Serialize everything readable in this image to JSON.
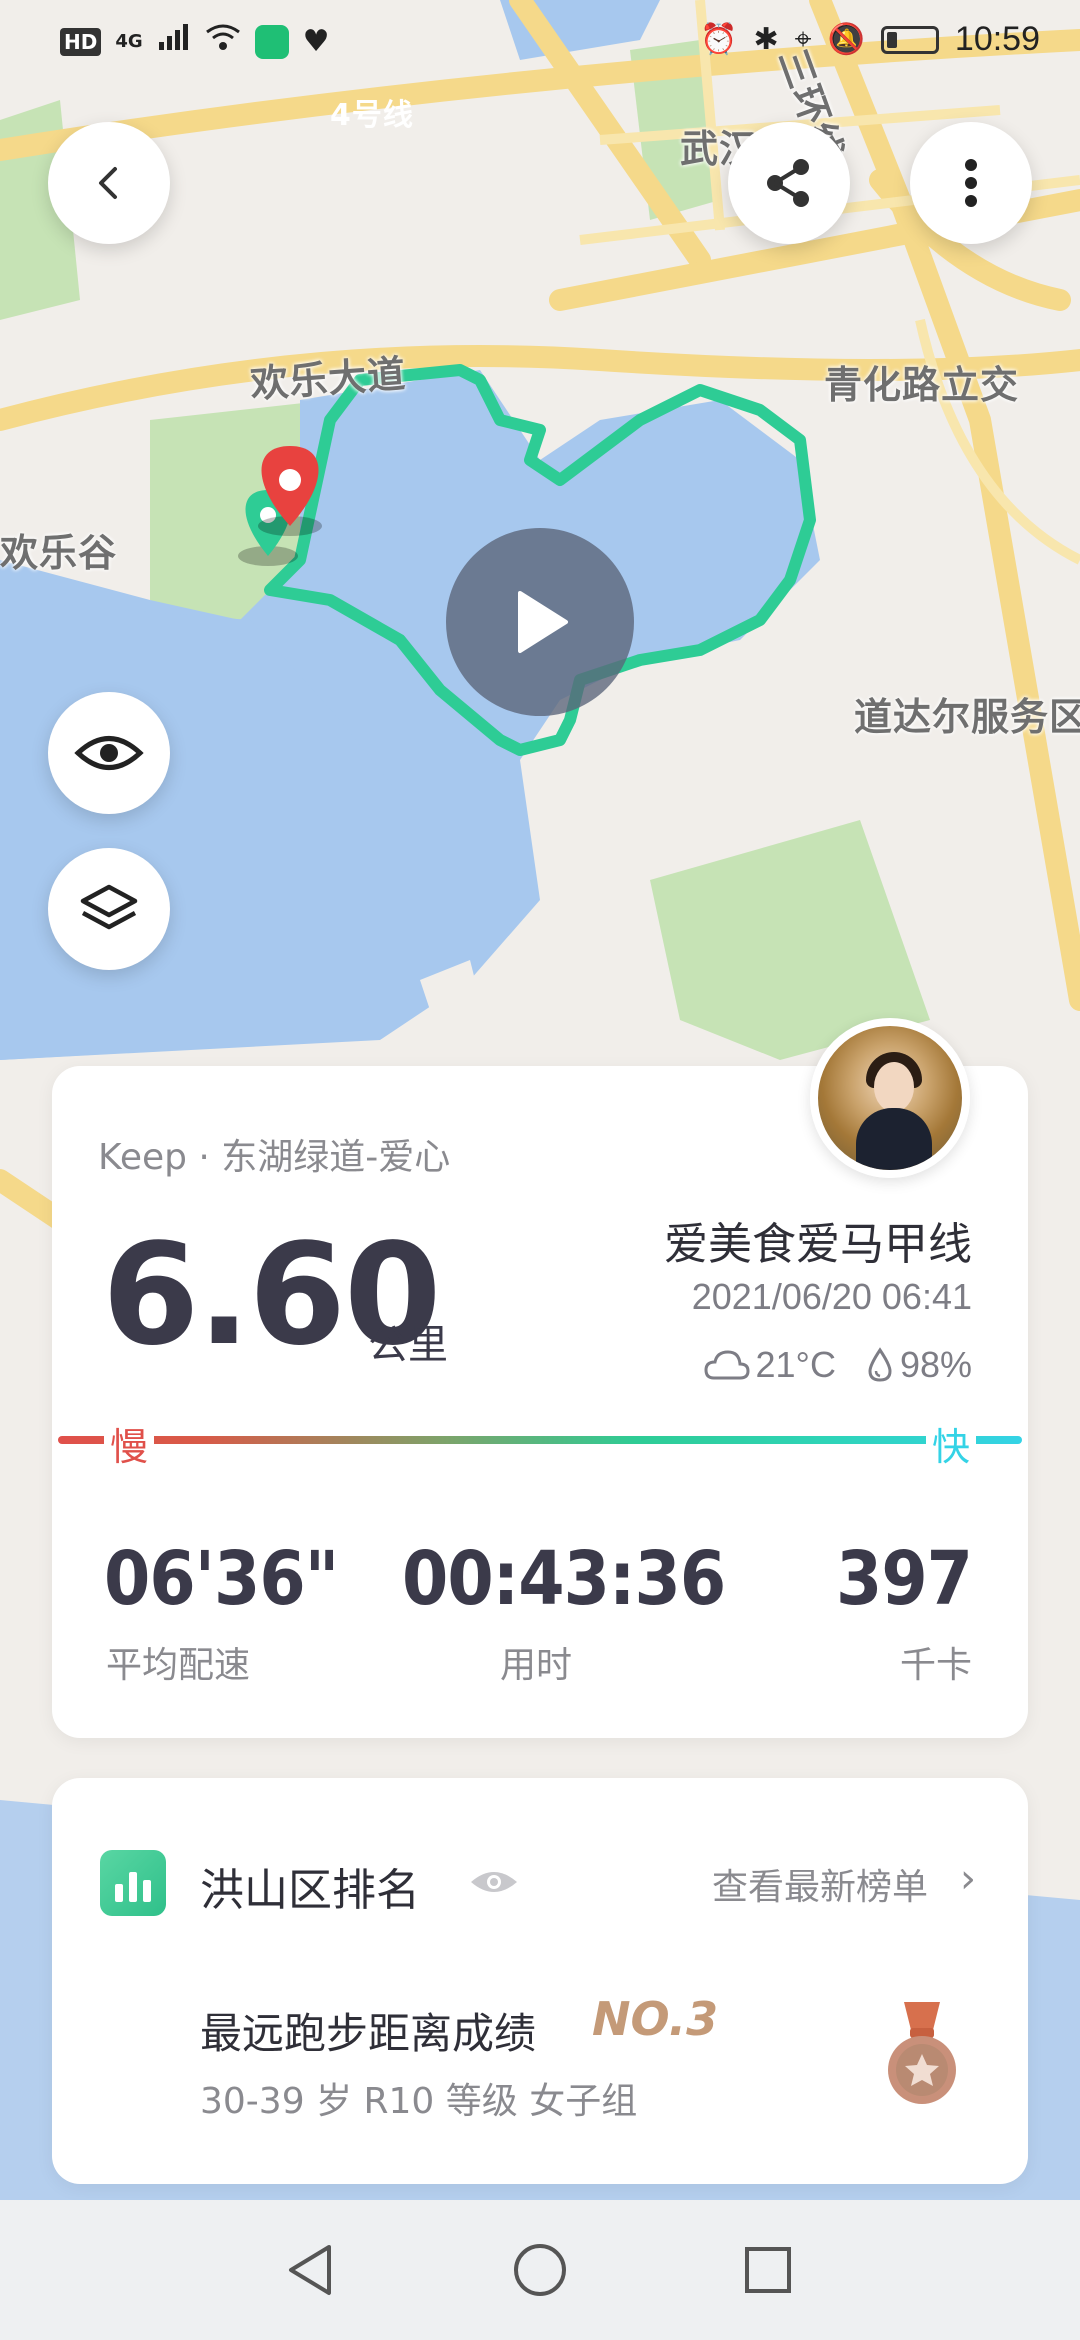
{
  "status_bar": {
    "network": "4G",
    "hd": "HD",
    "time": "10:59"
  },
  "map": {
    "road_labels": [
      "4号线",
      "武汉",
      "三环线",
      "欢乐大道",
      "青化路立交",
      "欢乐谷",
      "道达尔服务区"
    ],
    "route_color": "#2ecc95"
  },
  "header": {
    "back_icon": "back-arrow-icon",
    "share_icon": "share-icon",
    "more_icon": "more-vertical-icon"
  },
  "summary": {
    "source": "Keep · 东湖绿道-爱心",
    "distance": "6.60",
    "distance_unit": "公里",
    "username": "爱美食爱马甲线",
    "datetime": "2021/06/20 06:41",
    "temperature": "21°C",
    "humidity": "98%",
    "slow_label": "慢",
    "fast_label": "快",
    "stats": [
      {
        "value": "06'36\"",
        "label": "平均配速"
      },
      {
        "value": "00:43:36",
        "label": "用时"
      },
      {
        "value": "397",
        "label": "千卡"
      }
    ]
  },
  "ranking": {
    "title": "洪山区排名",
    "link_label": "查看最新榜单",
    "achievement_title": "最远跑步距离成绩",
    "achievement_rank": "NO.3",
    "achievement_group": "30-39 岁 R10 等级 女子组"
  },
  "colors": {
    "accent": "#2ecc95",
    "slow": "#e0504a",
    "fast": "#34d3e6",
    "text_dark": "#3b3a4a"
  }
}
